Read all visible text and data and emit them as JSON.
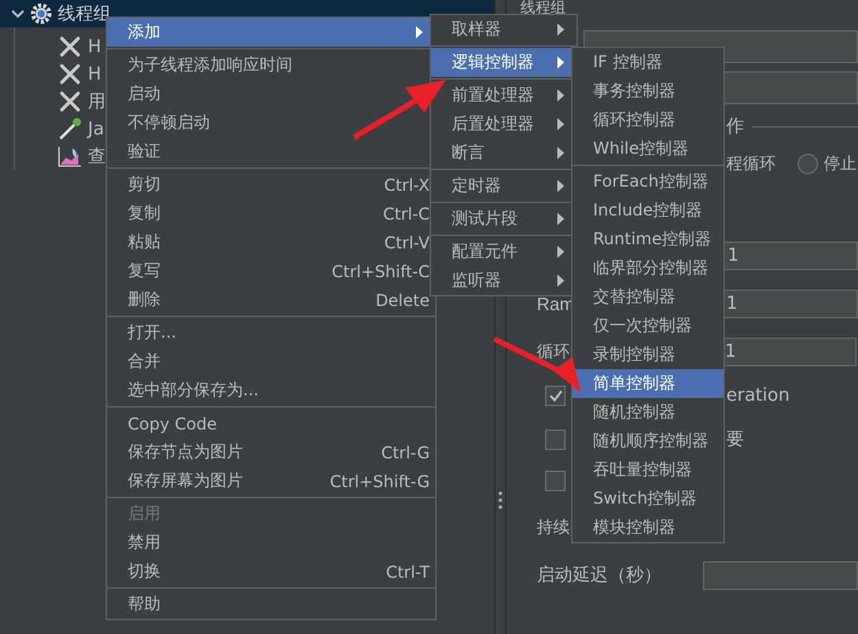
{
  "tree": {
    "root": {
      "label": "线程组",
      "expanded": true,
      "selected": true,
      "children": [
        {
          "label": "H",
          "kind": "tools"
        },
        {
          "label": "H",
          "kind": "tools"
        },
        {
          "label": "用",
          "kind": "tools"
        },
        {
          "label": "Ja",
          "kind": "dropper"
        },
        {
          "label": "查",
          "kind": "chart"
        }
      ]
    }
  },
  "panel": {
    "title": "线程组",
    "legend_fragment": "作",
    "radio_label_fragment": "程循环",
    "radio": {
      "label": "停止",
      "selected": false
    },
    "thread_count": "1",
    "ramp_label": "Ram",
    "ramp_value": "1",
    "loop_label": "循环",
    "loop_value": "1",
    "checkboxes": [
      {
        "label": "eration",
        "checked": true
      },
      {
        "label": "要",
        "checked": false
      },
      {
        "checked": false
      }
    ],
    "duration_label": "持续",
    "delay_label": "启动延迟（秒）"
  },
  "menus": [
    {
      "items": [
        {
          "kind": "item",
          "label": "添加",
          "submenu": true,
          "selected": true,
          "disabled": false
        },
        {
          "kind": "separator"
        },
        {
          "kind": "item",
          "label": "为子线程添加响应时间",
          "selected": false,
          "disabled": false
        },
        {
          "kind": "item",
          "label": "启动",
          "selected": false,
          "disabled": false
        },
        {
          "kind": "item",
          "label": "不停顿启动",
          "selected": false,
          "disabled": false
        },
        {
          "kind": "item",
          "label": "验证",
          "selected": false,
          "disabled": false
        },
        {
          "kind": "separator"
        },
        {
          "kind": "item",
          "label": "剪切",
          "shortcut": "Ctrl-X",
          "selected": false,
          "disabled": false
        },
        {
          "kind": "item",
          "label": "复制",
          "shortcut": "Ctrl-C",
          "selected": false,
          "disabled": false
        },
        {
          "kind": "item",
          "label": "粘贴",
          "shortcut": "Ctrl-V",
          "selected": false,
          "disabled": false
        },
        {
          "kind": "item",
          "label": "复写",
          "shortcut": "Ctrl+Shift-C",
          "selected": false,
          "disabled": false
        },
        {
          "kind": "item",
          "label": "删除",
          "shortcut": "Delete",
          "selected": false,
          "disabled": false
        },
        {
          "kind": "separator"
        },
        {
          "kind": "item",
          "label": "打开...",
          "selected": false,
          "disabled": false
        },
        {
          "kind": "item",
          "label": "合并",
          "selected": false,
          "disabled": false
        },
        {
          "kind": "item",
          "label": "选中部分保存为...",
          "selected": false,
          "disabled": false
        },
        {
          "kind": "separator"
        },
        {
          "kind": "item",
          "label": "Copy Code",
          "selected": false,
          "disabled": false
        },
        {
          "kind": "item",
          "label": "保存节点为图片",
          "shortcut": "Ctrl-G",
          "selected": false,
          "disabled": false
        },
        {
          "kind": "item",
          "label": "保存屏幕为图片",
          "shortcut": "Ctrl+Shift-G",
          "selected": false,
          "disabled": false
        },
        {
          "kind": "separator"
        },
        {
          "kind": "item",
          "label": "启用",
          "selected": false,
          "disabled": true
        },
        {
          "kind": "item",
          "label": "禁用",
          "selected": false,
          "disabled": false
        },
        {
          "kind": "item",
          "label": "切换",
          "shortcut": "Ctrl-T",
          "selected": false,
          "disabled": false
        },
        {
          "kind": "separator"
        },
        {
          "kind": "item",
          "label": "帮助",
          "selected": false,
          "disabled": false
        }
      ]
    },
    {
      "items": [
        {
          "kind": "item",
          "label": "取样器",
          "submenu": true,
          "selected": false
        },
        {
          "kind": "separator"
        },
        {
          "kind": "item",
          "label": "逻辑控制器",
          "submenu": true,
          "selected": true
        },
        {
          "kind": "separator"
        },
        {
          "kind": "item",
          "label": "前置处理器",
          "submenu": true,
          "selected": false
        },
        {
          "kind": "item",
          "label": "后置处理器",
          "submenu": true,
          "selected": false
        },
        {
          "kind": "item",
          "label": "断言",
          "submenu": true,
          "selected": false
        },
        {
          "kind": "separator"
        },
        {
          "kind": "item",
          "label": "定时器",
          "submenu": true,
          "selected": false
        },
        {
          "kind": "separator"
        },
        {
          "kind": "item",
          "label": "测试片段",
          "submenu": true,
          "selected": false
        },
        {
          "kind": "separator"
        },
        {
          "kind": "item",
          "label": "配置元件",
          "submenu": true,
          "selected": false
        },
        {
          "kind": "item",
          "label": "监听器",
          "submenu": true,
          "selected": false
        }
      ]
    },
    {
      "items": [
        {
          "kind": "item",
          "label": "IF 控制器",
          "selected": false
        },
        {
          "kind": "item",
          "label": "事务控制器",
          "selected": false
        },
        {
          "kind": "item",
          "label": "循环控制器",
          "selected": false
        },
        {
          "kind": "item",
          "label": "While控制器",
          "selected": false
        },
        {
          "kind": "separator"
        },
        {
          "kind": "item",
          "label": "ForEach控制器",
          "selected": false
        },
        {
          "kind": "item",
          "label": "Include控制器",
          "selected": false
        },
        {
          "kind": "item",
          "label": "Runtime控制器",
          "selected": false
        },
        {
          "kind": "item",
          "label": "临界部分控制器",
          "selected": false
        },
        {
          "kind": "item",
          "label": "交替控制器",
          "selected": false
        },
        {
          "kind": "item",
          "label": "仅一次控制器",
          "selected": false
        },
        {
          "kind": "item",
          "label": "录制控制器",
          "selected": false
        },
        {
          "kind": "item",
          "label": "简单控制器",
          "selected": true
        },
        {
          "kind": "item",
          "label": "随机控制器",
          "selected": false
        },
        {
          "kind": "item",
          "label": "随机顺序控制器",
          "selected": false
        },
        {
          "kind": "item",
          "label": "吞吐量控制器",
          "selected": false
        },
        {
          "kind": "item",
          "label": "Switch控制器",
          "selected": false
        },
        {
          "kind": "item",
          "label": "模块控制器",
          "selected": false
        }
      ]
    }
  ]
}
